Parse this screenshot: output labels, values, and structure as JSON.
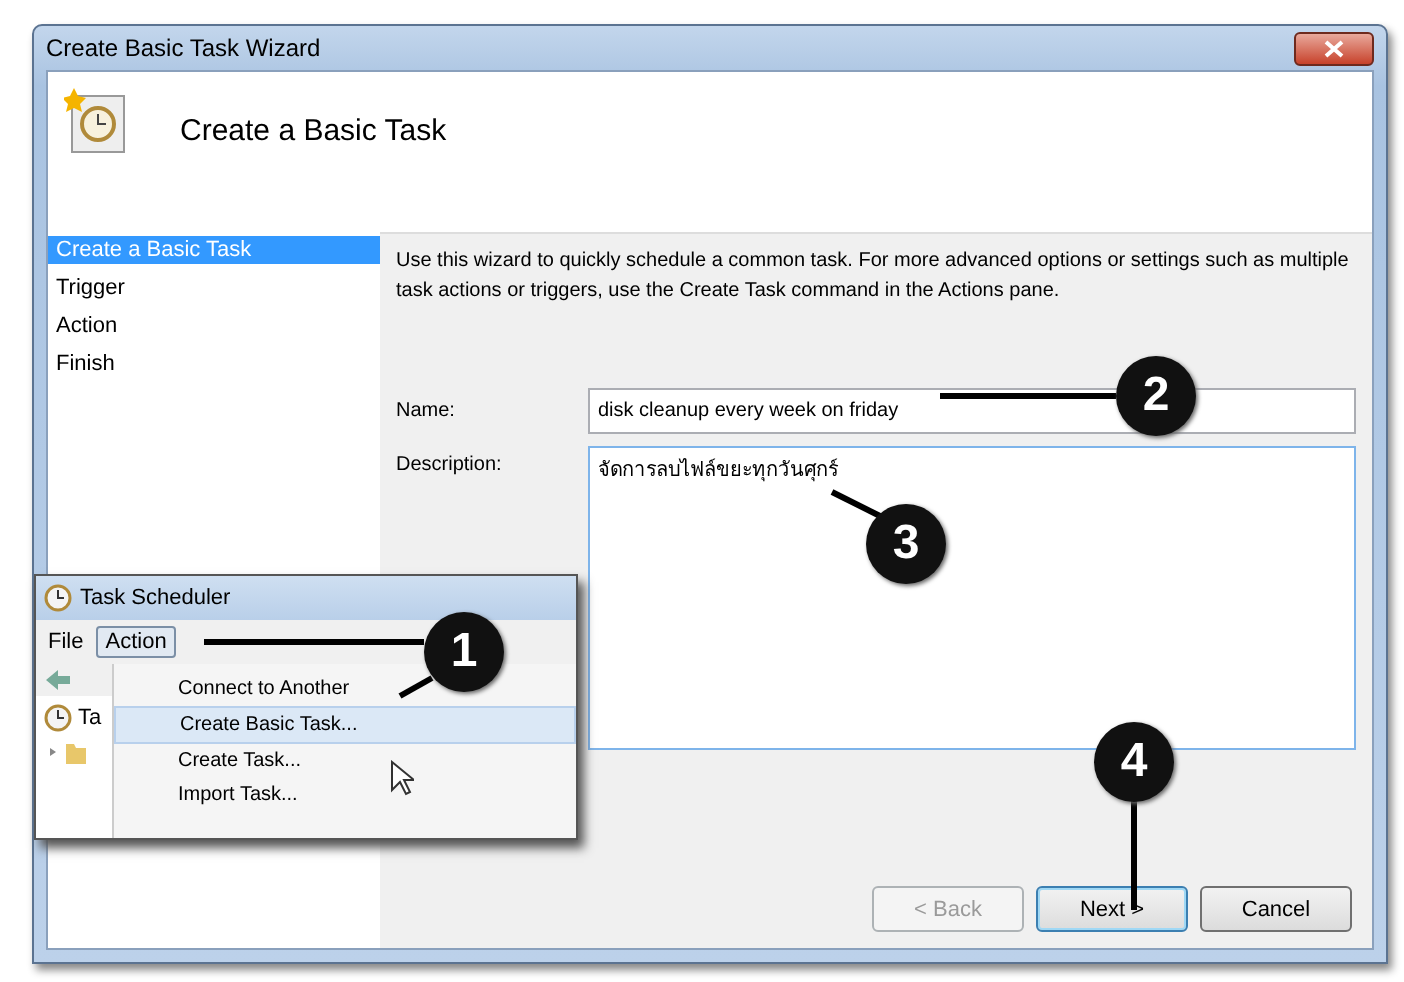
{
  "window": {
    "title": "Create Basic Task Wizard",
    "heading": "Create a Basic Task"
  },
  "steps": [
    {
      "label": "Create a Basic Task",
      "selected": true
    },
    {
      "label": "Trigger",
      "selected": false
    },
    {
      "label": "Action",
      "selected": false
    },
    {
      "label": "Finish",
      "selected": false
    }
  ],
  "intro": "Use this wizard to quickly schedule a common task.  For more advanced options or settings such as multiple task actions or triggers, use the Create Task command in the Actions pane.",
  "name_field": {
    "label": "Name:",
    "value": "disk cleanup every week on friday"
  },
  "description_field": {
    "label": "Description:",
    "value": "จัดการลบไฟล์ขยะทุกวันศุกร์"
  },
  "buttons": [
    {
      "label": "< Back",
      "disabled": true,
      "selected": false
    },
    {
      "label": "Next >",
      "disabled": false,
      "selected": true
    },
    {
      "label": "Cancel",
      "disabled": false,
      "selected": false
    }
  ],
  "inset": {
    "title": "Task Scheduler",
    "menu": [
      {
        "label": "File",
        "selected": false
      },
      {
        "label": "Action",
        "selected": true
      }
    ],
    "tree_item": "Ta",
    "dropdown": [
      {
        "label": "Connect to Another",
        "selected": false
      },
      {
        "label": "Create Basic Task...",
        "selected": true
      },
      {
        "label": "Create Task...",
        "selected": false
      },
      {
        "label": "Import Task...",
        "selected": false
      }
    ]
  },
  "callouts": [
    "1",
    "2",
    "3",
    "4"
  ]
}
